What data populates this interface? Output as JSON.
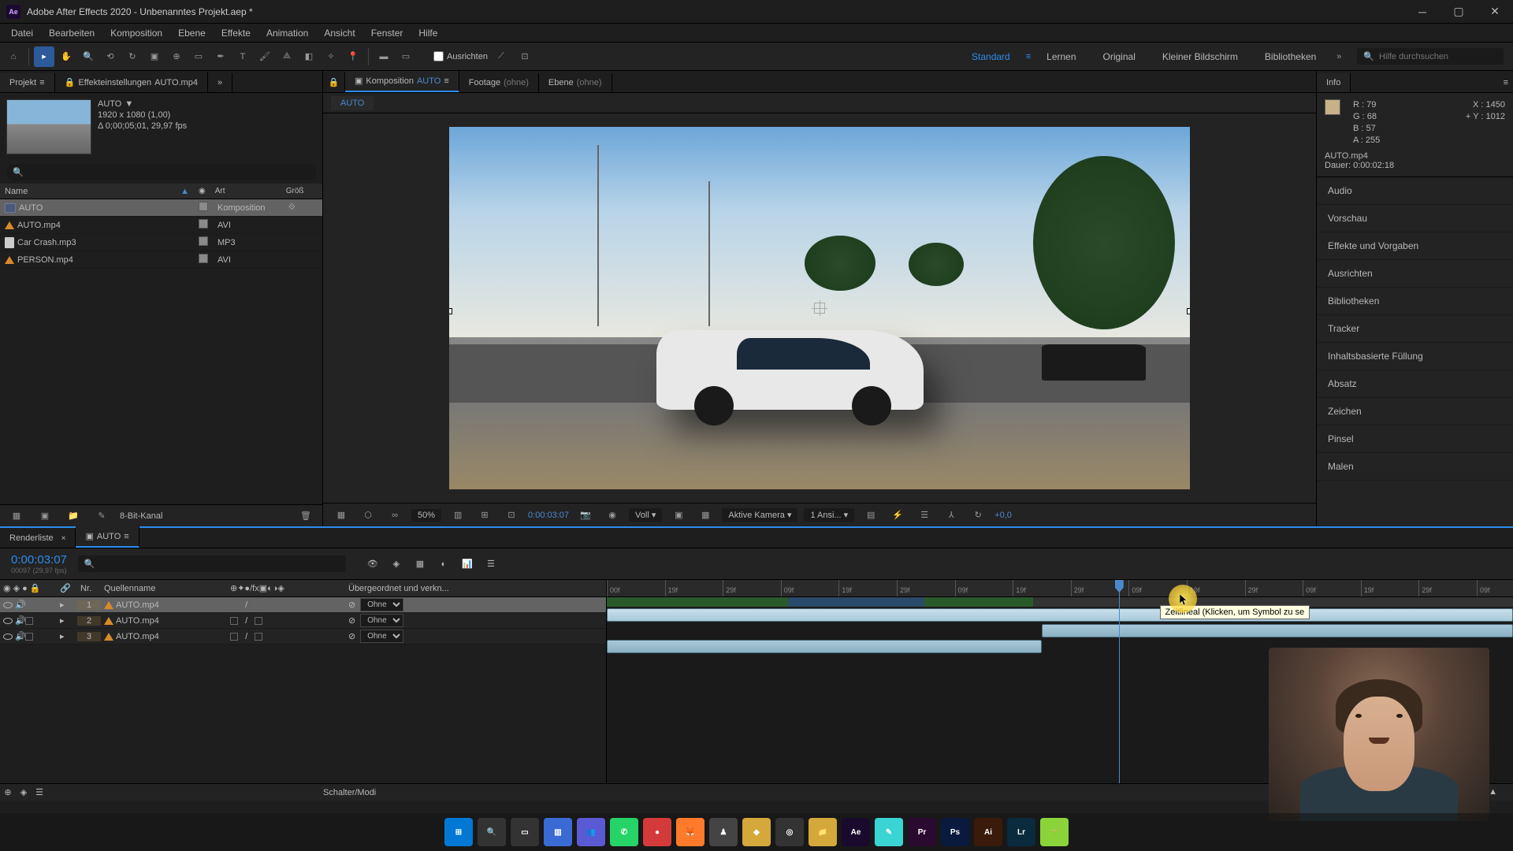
{
  "title": "Adobe After Effects 2020 - Unbenanntes Projekt.aep *",
  "menus": [
    "Datei",
    "Bearbeiten",
    "Komposition",
    "Ebene",
    "Effekte",
    "Animation",
    "Ansicht",
    "Fenster",
    "Hilfe"
  ],
  "toolbar": {
    "align_label": "Ausrichten"
  },
  "workspaces": [
    "Standard",
    "Lernen",
    "Original",
    "Kleiner Bildschirm",
    "Bibliotheken"
  ],
  "active_workspace": "Standard",
  "search_placeholder": "Hilfe durchsuchen",
  "left_tabs": {
    "projekt": "Projekt",
    "effekteinst": "Effekteinstellungen",
    "effekteinst_item": "AUTO.mp4"
  },
  "projpanel": {
    "selected_name": "AUTO",
    "selected_flag": "▼",
    "dim": "1920 x 1080 (1,00)",
    "dur": "Δ 0;00;05;01, 29,97 fps",
    "cols": {
      "name": "Name",
      "art": "Art",
      "groesse": "Größ"
    },
    "rows": [
      {
        "icon": "comp",
        "name": "AUTO",
        "art": "Komposition",
        "sel": true
      },
      {
        "icon": "avi",
        "name": "AUTO.mp4",
        "art": "AVI"
      },
      {
        "icon": "mp3",
        "name": "Car Crash.mp3",
        "art": "MP3"
      },
      {
        "icon": "avi",
        "name": "PERSON.mp4",
        "art": "AVI"
      }
    ],
    "footer_bpc": "8-Bit-Kanal"
  },
  "center_tabs": {
    "comp": "Komposition",
    "comp_item": "AUTO",
    "footage": "Footage",
    "footage_item": "(ohne)",
    "layer": "Ebene",
    "layer_item": "(ohne)"
  },
  "crumb": "AUTO",
  "viewerbar": {
    "zoom": "50%",
    "time": "0:00:03:07",
    "res": "Voll",
    "camera": "Aktive Kamera",
    "views": "1 Ansi...",
    "exposure": "+0,0"
  },
  "info": {
    "title": "Info",
    "r": "R :",
    "r_v": "79",
    "g": "G :",
    "g_v": "68",
    "b": "B :",
    "b_v": "57",
    "a": "A :",
    "a_v": "255",
    "x": "X :",
    "x_v": "1450",
    "y": "Y :",
    "y_v": "1012",
    "clip": "AUTO.mp4",
    "dur": "Dauer: 0:00:02:18"
  },
  "right_panels": [
    "Audio",
    "Vorschau",
    "Effekte und Vorgaben",
    "Ausrichten",
    "Bibliotheken",
    "Tracker",
    "Inhaltsbasierte Füllung",
    "Absatz",
    "Zeichen",
    "Pinsel",
    "Malen"
  ],
  "timeline": {
    "tabs": {
      "render": "Renderliste",
      "comp": "AUTO"
    },
    "time": "0:00:03:07",
    "subtime": "00097 (29,97 fps)",
    "cols": {
      "nr": "Nr.",
      "quelle": "Quellenname",
      "parent": "Übergeordnet und verkn..."
    },
    "layers": [
      {
        "nr": "1",
        "name": "AUTO.mp4",
        "parent": "Ohne",
        "sel": true
      },
      {
        "nr": "2",
        "name": "AUTO.mp4",
        "parent": "Ohne"
      },
      {
        "nr": "3",
        "name": "AUTO.mp4",
        "parent": "Ohne"
      }
    ],
    "ruler_ticks": [
      "00f",
      "19f",
      "29f",
      "09f",
      "19f",
      "29f",
      "09f",
      "19f",
      "29f",
      "09f",
      "19f",
      "29f",
      "09f",
      "19f",
      "29f",
      "09f"
    ],
    "tooltip": "Zeitlineal (Klicken, um Symbol zu se",
    "footer": "Schalter/Modi"
  },
  "taskbar_icons": [
    {
      "name": "start",
      "txt": "⊞",
      "bg": "#0078d4"
    },
    {
      "name": "search",
      "txt": "🔍",
      "bg": "#333"
    },
    {
      "name": "taskview",
      "txt": "▭",
      "bg": "#333"
    },
    {
      "name": "widgets",
      "txt": "▥",
      "bg": "#3a6ad4"
    },
    {
      "name": "teams",
      "txt": "👥",
      "bg": "#5a5ad4"
    },
    {
      "name": "whatsapp",
      "txt": "✆",
      "bg": "#25d366"
    },
    {
      "name": "app1",
      "txt": "●",
      "bg": "#d43a3a"
    },
    {
      "name": "firefox",
      "txt": "🦊",
      "bg": "#ff7a2a"
    },
    {
      "name": "app2",
      "txt": "♟",
      "bg": "#444"
    },
    {
      "name": "app3",
      "txt": "◆",
      "bg": "#d4a83a"
    },
    {
      "name": "obs",
      "txt": "◎",
      "bg": "#333"
    },
    {
      "name": "explorer",
      "txt": "📁",
      "bg": "#d4a83a"
    },
    {
      "name": "ae",
      "txt": "Ae",
      "bg": "#1a0a2e"
    },
    {
      "name": "app4",
      "txt": "✎",
      "bg": "#3ad4d4"
    },
    {
      "name": "pr",
      "txt": "Pr",
      "bg": "#2a0a2e"
    },
    {
      "name": "ps",
      "txt": "Ps",
      "bg": "#0a1a3e"
    },
    {
      "name": "ai",
      "txt": "Ai",
      "bg": "#3a1a0a"
    },
    {
      "name": "lr",
      "txt": "Lr",
      "bg": "#0a2a3e"
    },
    {
      "name": "app5",
      "txt": "🌱",
      "bg": "#8ad43a"
    }
  ]
}
